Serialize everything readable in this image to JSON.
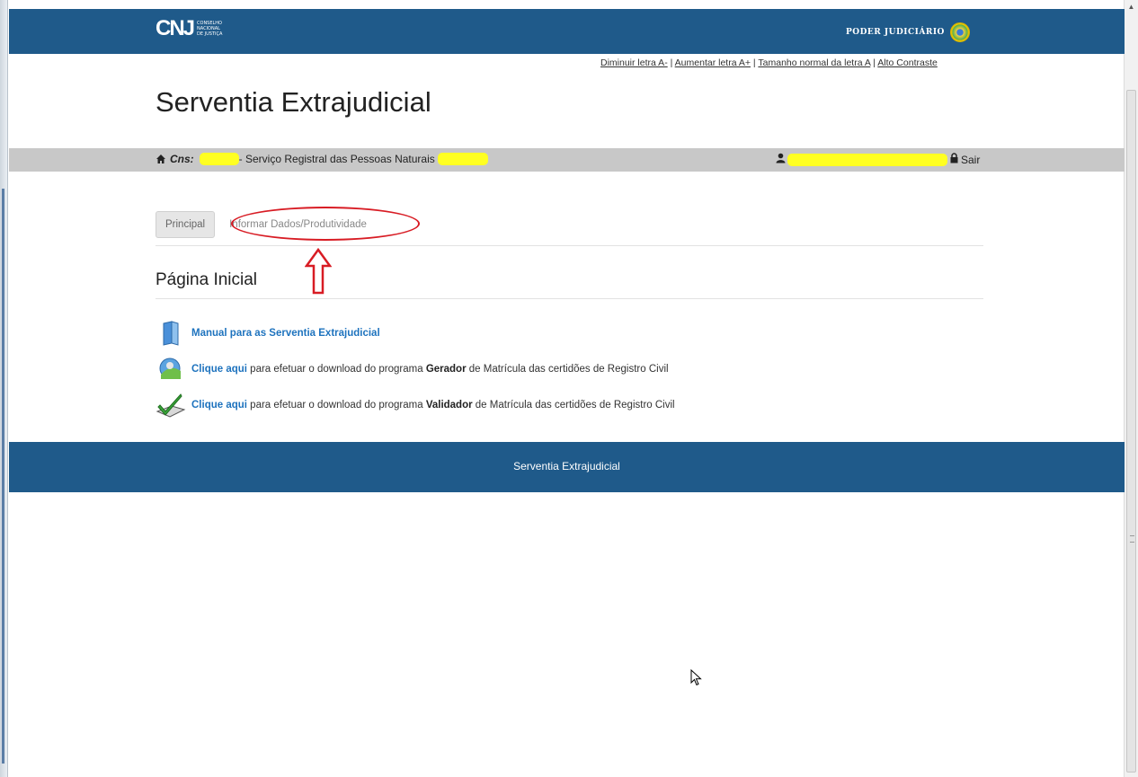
{
  "header": {
    "logo_mark": "CNJ",
    "logo_text": "CONSELHO NACIONAL DE JUSTIÇA",
    "right_label": "PODER JUDICIÁRIO"
  },
  "accessibility": {
    "decrease": "Diminuir letra A-",
    "increase": "Aumentar letra A+",
    "normal": "Tamanho normal da letra A",
    "contrast": "Alto Contraste"
  },
  "site_title": "Serventia Extrajudicial",
  "userbar": {
    "cns_label": "Cns:",
    "service": "- Serviço Registral das Pessoas Naturais",
    "logout": "Sair"
  },
  "tabs": [
    {
      "label": "Principal"
    },
    {
      "label": "Informar Dados/Produtividade"
    }
  ],
  "page_heading": "Página Inicial",
  "links": {
    "manual": "Manual para as Serventia Extrajudicial",
    "gerador_link": "Clique aqui",
    "gerador_pre": " para efetuar o download do programa ",
    "gerador_bold": "Gerador",
    "gerador_post": " de Matrícula das certidões de Registro Civil",
    "validador_link": "Clique aqui",
    "validador_pre": " para efetuar o download do programa ",
    "validador_bold": "Validador",
    "validador_post": " de Matrícula das certidões de Registro Civil"
  },
  "footer": "Serventia Extrajudicial",
  "colors": {
    "brand": "#1f5a8a",
    "link": "#1e73be",
    "annotation": "#d81c24",
    "highlight": "#ffff22"
  }
}
